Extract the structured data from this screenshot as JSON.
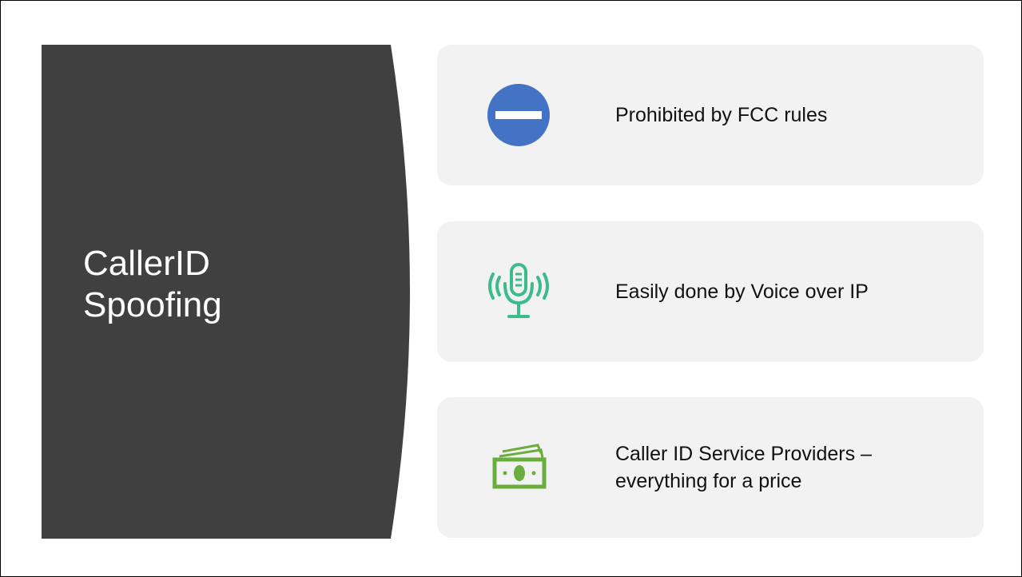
{
  "slide": {
    "title_lines": [
      "CallerID",
      "Spoofing"
    ],
    "panel_color": "#404040",
    "card_color": "#f2f2f2",
    "items": [
      {
        "text": "Prohibited by FCC rules",
        "icon": "no-entry-icon",
        "icon_color": "#4472c4"
      },
      {
        "text": "Easily done by Voice over IP",
        "icon": "microphone-icon",
        "icon_color": "#3cbb8c"
      },
      {
        "text": "Caller ID Service Providers – everything for a price",
        "icon": "money-icon",
        "icon_color": "#6aae3e"
      }
    ]
  }
}
